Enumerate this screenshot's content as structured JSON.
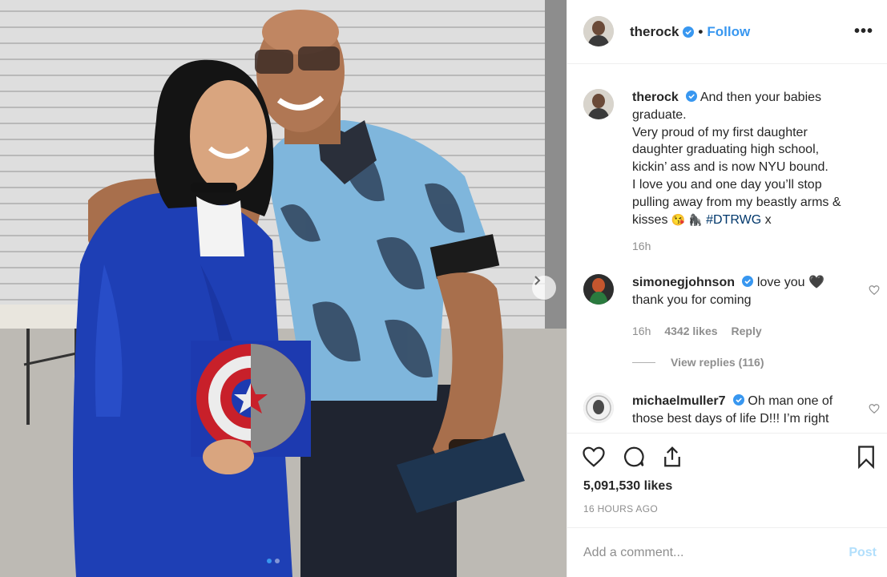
{
  "photo": {
    "alt_subject": "graduation-photo",
    "carousel_index": 1,
    "carousel_total": 2
  },
  "post": {
    "username": "therock",
    "follow_label": "Follow",
    "bullet": "•",
    "more_label": "•••"
  },
  "caption": {
    "username": "therock",
    "text_lines": [
      "And then your babies",
      "graduate.",
      "Very proud of my first daughter",
      "daughter graduating high school,",
      "kickin’ ass and is now NYU bound.",
      "I love you and one day you’ll stop",
      "pulling away from my beastly arms &",
      "kisses"
    ],
    "emojis": "😘 🦍",
    "hashtag": "#DTRWG",
    "suffix": " x",
    "time": "16h"
  },
  "comments": [
    {
      "username": "simonegjohnson",
      "text_line1": "love you 🖤",
      "text_line2": "thank you for coming",
      "time": "16h",
      "likes": "4342 likes",
      "reply_label": "Reply",
      "view_replies": "View replies (116)"
    },
    {
      "username": "michaelmuller7",
      "text_line1": "Oh man one of",
      "text_line2": "those best days of life D!!! I’m right"
    }
  ],
  "stats": {
    "likes": "5,091,530 likes",
    "time_ago": "16 HOURS AGO"
  },
  "add_comment": {
    "placeholder": "Add a comment...",
    "post_label": "Post"
  },
  "colors": {
    "link_blue": "#3897f0",
    "hashtag_blue": "#00376b",
    "muted": "#8e8e8e",
    "post_disabled": "#b2dffc"
  }
}
